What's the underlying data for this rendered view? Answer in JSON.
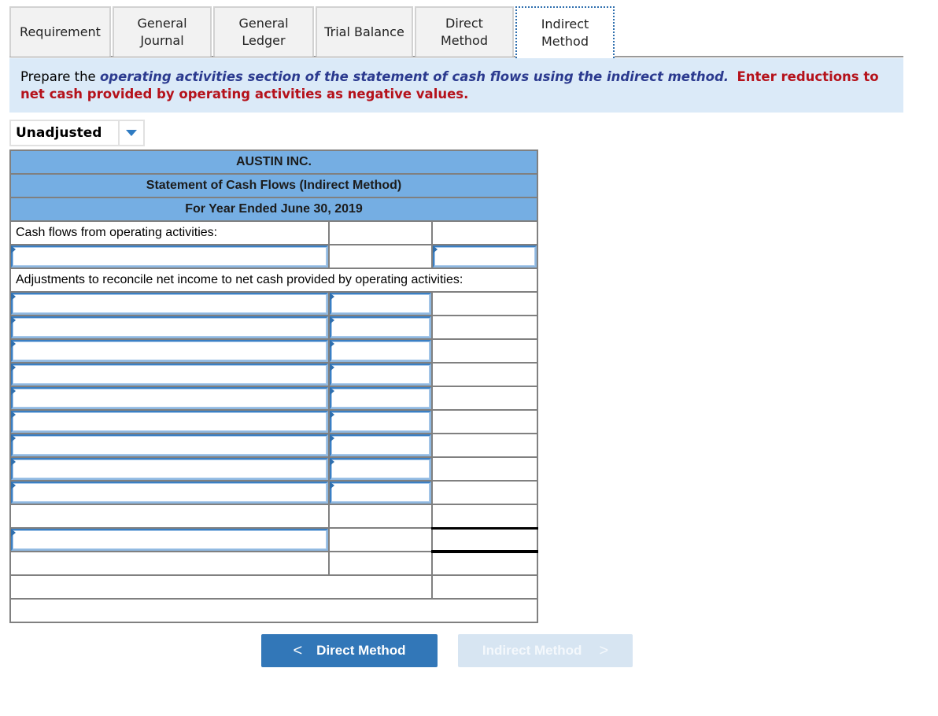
{
  "tabs": [
    {
      "label": "Requirement",
      "active": false
    },
    {
      "label": "General Journal",
      "active": false
    },
    {
      "label": "General Ledger",
      "active": false
    },
    {
      "label": "Trial Balance",
      "active": false
    },
    {
      "label": "Direct Method",
      "active": false
    },
    {
      "label": "Indirect Method",
      "active": true
    }
  ],
  "instruction": {
    "prefix": "Prepare the ",
    "emphasis": "operating activities section of the statement of cash flows using the indirect method.",
    "warning": "Enter reductions to net cash provided by operating activities as negative values."
  },
  "dropdown": {
    "selected": "Unadjusted"
  },
  "statement": {
    "company": "AUSTIN INC.",
    "title": "Statement of Cash Flows (Indirect Method)",
    "period": "For Year Ended June 30, 2019",
    "section_label": "Cash flows from operating activities:",
    "adjustments_label": "Adjustments to reconcile net income to net cash provided by operating activities:",
    "net_income_row": {
      "label_value": "",
      "amount_value": ""
    },
    "adjustment_rows": [
      {
        "label_value": "",
        "amount_value": ""
      },
      {
        "label_value": "",
        "amount_value": ""
      },
      {
        "label_value": "",
        "amount_value": ""
      },
      {
        "label_value": "",
        "amount_value": ""
      },
      {
        "label_value": "",
        "amount_value": ""
      },
      {
        "label_value": "",
        "amount_value": ""
      },
      {
        "label_value": "",
        "amount_value": ""
      },
      {
        "label_value": "",
        "amount_value": ""
      },
      {
        "label_value": "",
        "amount_value": ""
      }
    ],
    "total_row": {
      "label_value": ""
    }
  },
  "buttons": {
    "prev_label": "Direct Method",
    "next_label": "Indirect Method",
    "prev_icon": "chevron-left-icon",
    "next_icon": "chevron-right-icon"
  }
}
